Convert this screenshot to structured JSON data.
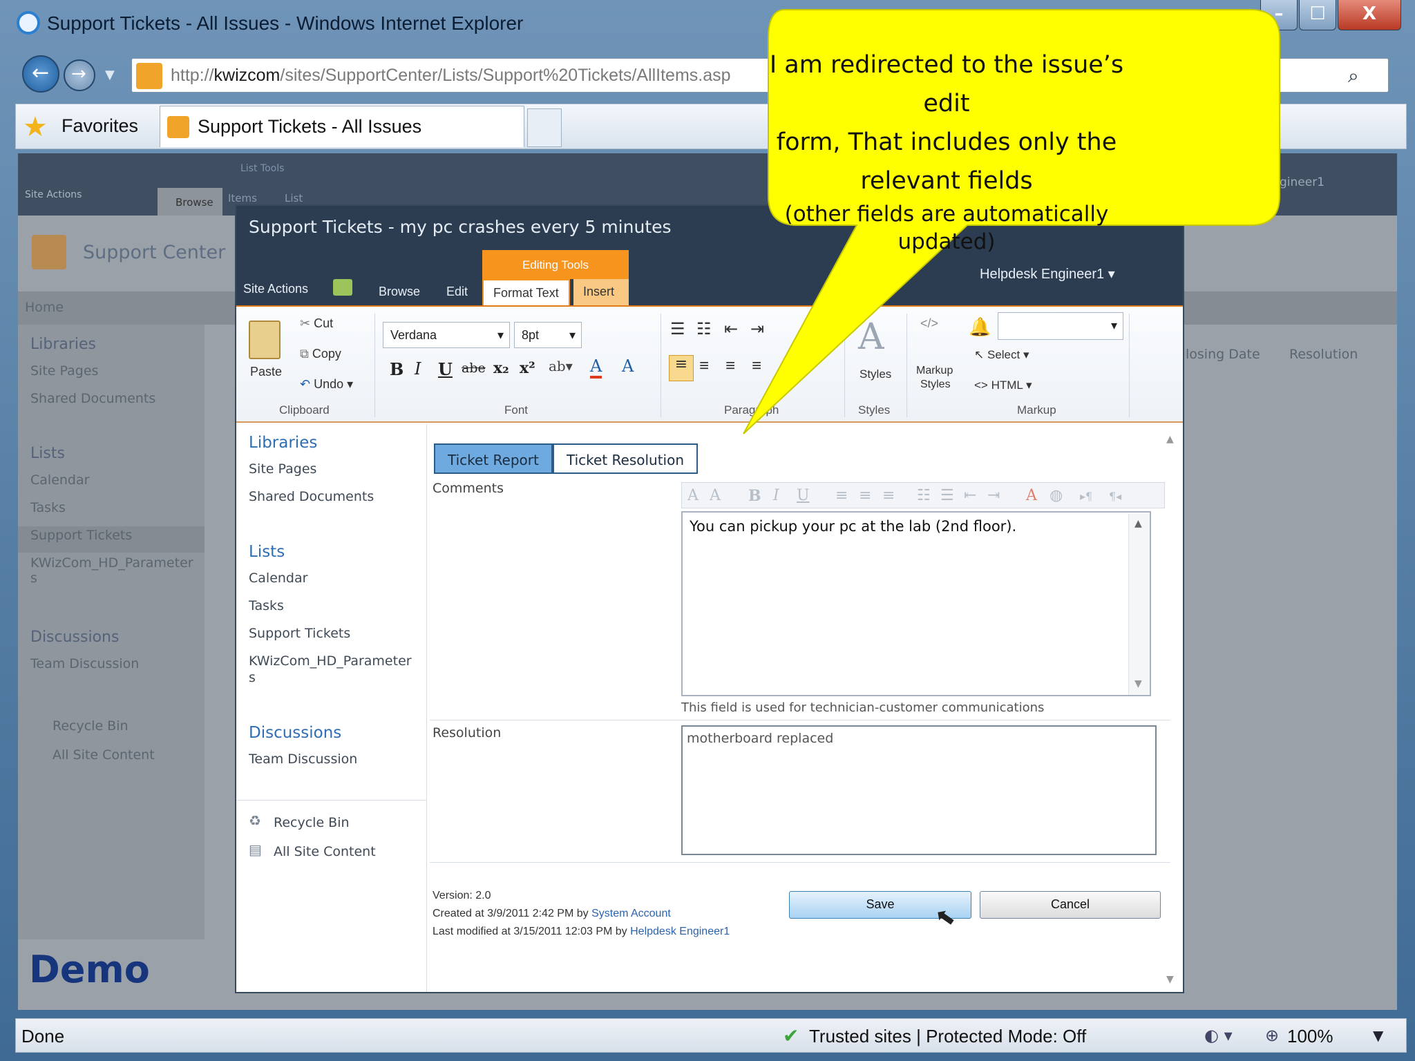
{
  "browser": {
    "window_title": "Support Tickets - All Issues - Windows Internet Explorer",
    "url_prefix": "http://",
    "url_host": "kwizcom",
    "url_path": "/sites/SupportCenter/Lists/Support%20Tickets/AllItems.asp",
    "favorites_label": "Favorites",
    "tab_label": "Support Tickets - All Issues",
    "status_done": "Done",
    "status_zone": "Trusted sites | Protected Mode: Off",
    "zoom": "100%"
  },
  "site": {
    "list_tools": "List Tools",
    "site_actions": "Site Actions",
    "browse": "Browse",
    "items": "Items",
    "list": "List",
    "title": "Support Center",
    "home": "Home",
    "user": "gineer1",
    "col_closing": "losing Date",
    "col_resolution": "Resolution",
    "nav": {
      "libraries": "Libraries",
      "site_pages": "Site Pages",
      "shared_docs": "Shared Documents",
      "lists": "Lists",
      "calendar": "Calendar",
      "tasks": "Tasks",
      "support_tickets": "Support Tickets",
      "kwiz_a": "KWizCom_HD_Parameter",
      "kwiz_b": "s",
      "discussions": "Discussions",
      "team_discussion": "Team Discussion",
      "recycle_bin": "Recycle Bin",
      "all_site_content": "All Site Content"
    }
  },
  "dialog": {
    "title": "Support Tickets - my pc crashes every 5 minutes",
    "editing_tools": "Editing Tools",
    "tabs": {
      "site_actions": "Site Actions",
      "browse": "Browse",
      "edit": "Edit",
      "format_text": "Format Text",
      "insert": "Insert"
    },
    "user": "Helpdesk Engineer1",
    "ribbon": {
      "cut": "Cut",
      "copy": "Copy",
      "paste": "Paste",
      "undo": "Undo",
      "font_name": "Verdana",
      "font_size": "8pt",
      "styles": "Styles",
      "markup_styles_a": "Markup",
      "markup_styles_b": "Styles",
      "select": "Select",
      "html": "HTML",
      "group_clipboard": "Clipboard",
      "group_font": "Font",
      "group_paragraph": "Paragraph",
      "group_styles": "Styles",
      "group_markup": "Markup"
    },
    "nav": {
      "libraries": "Libraries",
      "site_pages": "Site Pages",
      "shared_docs": "Shared Documents",
      "lists": "Lists",
      "calendar": "Calendar",
      "tasks": "Tasks",
      "support_tickets": "Support Tickets",
      "kwiz_a": "KWizCom_HD_Parameter",
      "kwiz_b": "s",
      "discussions": "Discussions",
      "team_discussion": "Team Discussion",
      "recycle_bin": "Recycle Bin",
      "all_site_content": "All Site Content"
    },
    "form_tabs": {
      "report": "Ticket Report",
      "resolution": "Ticket Resolution"
    },
    "fields": {
      "comments_label": "Comments",
      "comments_value": "You can pickup your pc at the lab (2nd floor).",
      "comments_hint": "This field is used for technician-customer communications",
      "resolution_label": "Resolution",
      "resolution_value": "motherboard replaced"
    },
    "meta": {
      "version": "Version: 2.0",
      "created_prefix": "Created at 3/9/2011 2:42 PM by",
      "created_by": "System Account",
      "modified_prefix": "Last modified at 3/15/2011 12:03 PM by",
      "modified_by": "Helpdesk Engineer1"
    },
    "save": "Save",
    "cancel": "Cancel"
  },
  "callout": {
    "line1": "I am redirected to the issue’s edit",
    "line2": "form, That includes only the",
    "line3": "relevant fields",
    "line4": "(other fields are automatically updated)",
    "color": "#ffff00"
  },
  "watermark": "Demo",
  "colors": {
    "ribbon_accent": "#f7941d",
    "sp_dark": "#2c3d52",
    "link": "#2f6db4"
  }
}
